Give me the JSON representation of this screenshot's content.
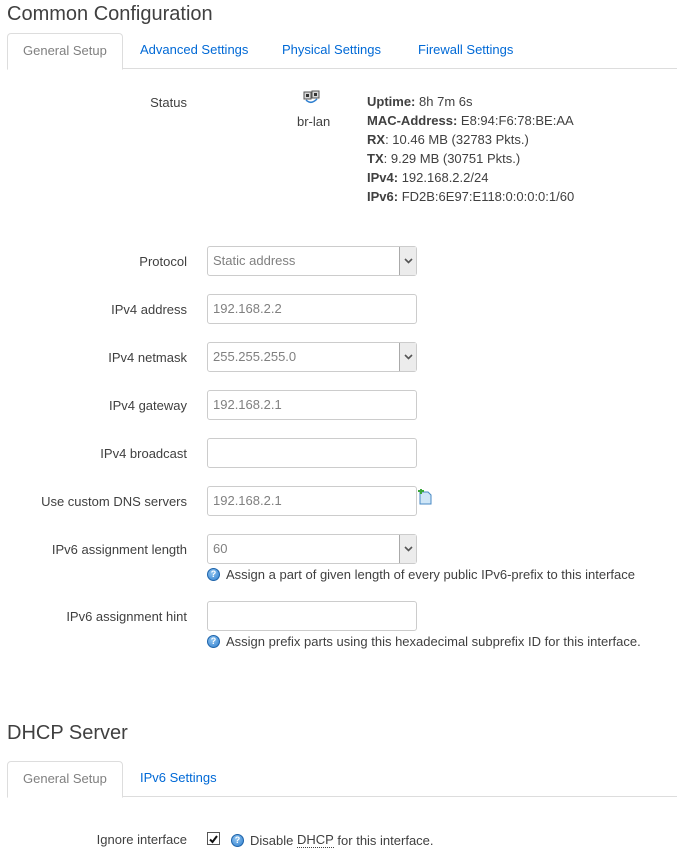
{
  "common": {
    "title": "Common Configuration",
    "tabs": [
      {
        "label": "General Setup",
        "active": true
      },
      {
        "label": "Advanced Settings",
        "active": false
      },
      {
        "label": "Physical Settings",
        "active": false
      },
      {
        "label": "Firewall Settings",
        "active": false
      }
    ],
    "status": {
      "label": "Status",
      "interface_icon": "network-interface-icon",
      "interface_name": "br-lan",
      "uptime_key": "Uptime:",
      "uptime_val": "8h 7m 6s",
      "mac_key": "MAC-Address:",
      "mac_val": "E8:94:F6:78:BE:AA",
      "rx_key": "RX",
      "rx_val": ": 10.46 MB (32783 Pkts.)",
      "tx_key": "TX",
      "tx_val": ": 9.29 MB (30751 Pkts.)",
      "ipv4_key": "IPv4:",
      "ipv4_val": "192.168.2.2/24",
      "ipv6_key": "IPv6:",
      "ipv6_val": "FD2B:6E97:E118:0:0:0:0:1/60"
    },
    "fields": {
      "protocol": {
        "label": "Protocol",
        "value": "Static address"
      },
      "ipv4_address": {
        "label": "IPv4 address",
        "value": "192.168.2.2"
      },
      "ipv4_netmask": {
        "label": "IPv4 netmask",
        "value": "255.255.255.0"
      },
      "ipv4_gateway": {
        "label": "IPv4 gateway",
        "value": "192.168.2.1"
      },
      "ipv4_broadcast": {
        "label": "IPv4 broadcast",
        "value": ""
      },
      "dns": {
        "label": "Use custom DNS servers",
        "value": "192.168.2.1",
        "add_icon": "add-entry-icon"
      },
      "ipv6_len": {
        "label": "IPv6 assignment length",
        "value": "60",
        "help": "Assign a part of given length of every public IPv6-prefix to this interface"
      },
      "ipv6_hint": {
        "label": "IPv6 assignment hint",
        "value": "",
        "help": "Assign prefix parts using this hexadecimal subprefix ID for this interface."
      }
    }
  },
  "dhcp": {
    "title": "DHCP Server",
    "tabs": [
      {
        "label": "General Setup",
        "active": true
      },
      {
        "label": "IPv6 Settings",
        "active": false
      }
    ],
    "ignore": {
      "label": "Ignore interface",
      "checked": true,
      "help_pre": "Disable ",
      "help_abbr": "DHCP",
      "help_post": " for this interface."
    }
  },
  "help_glyph": "?"
}
